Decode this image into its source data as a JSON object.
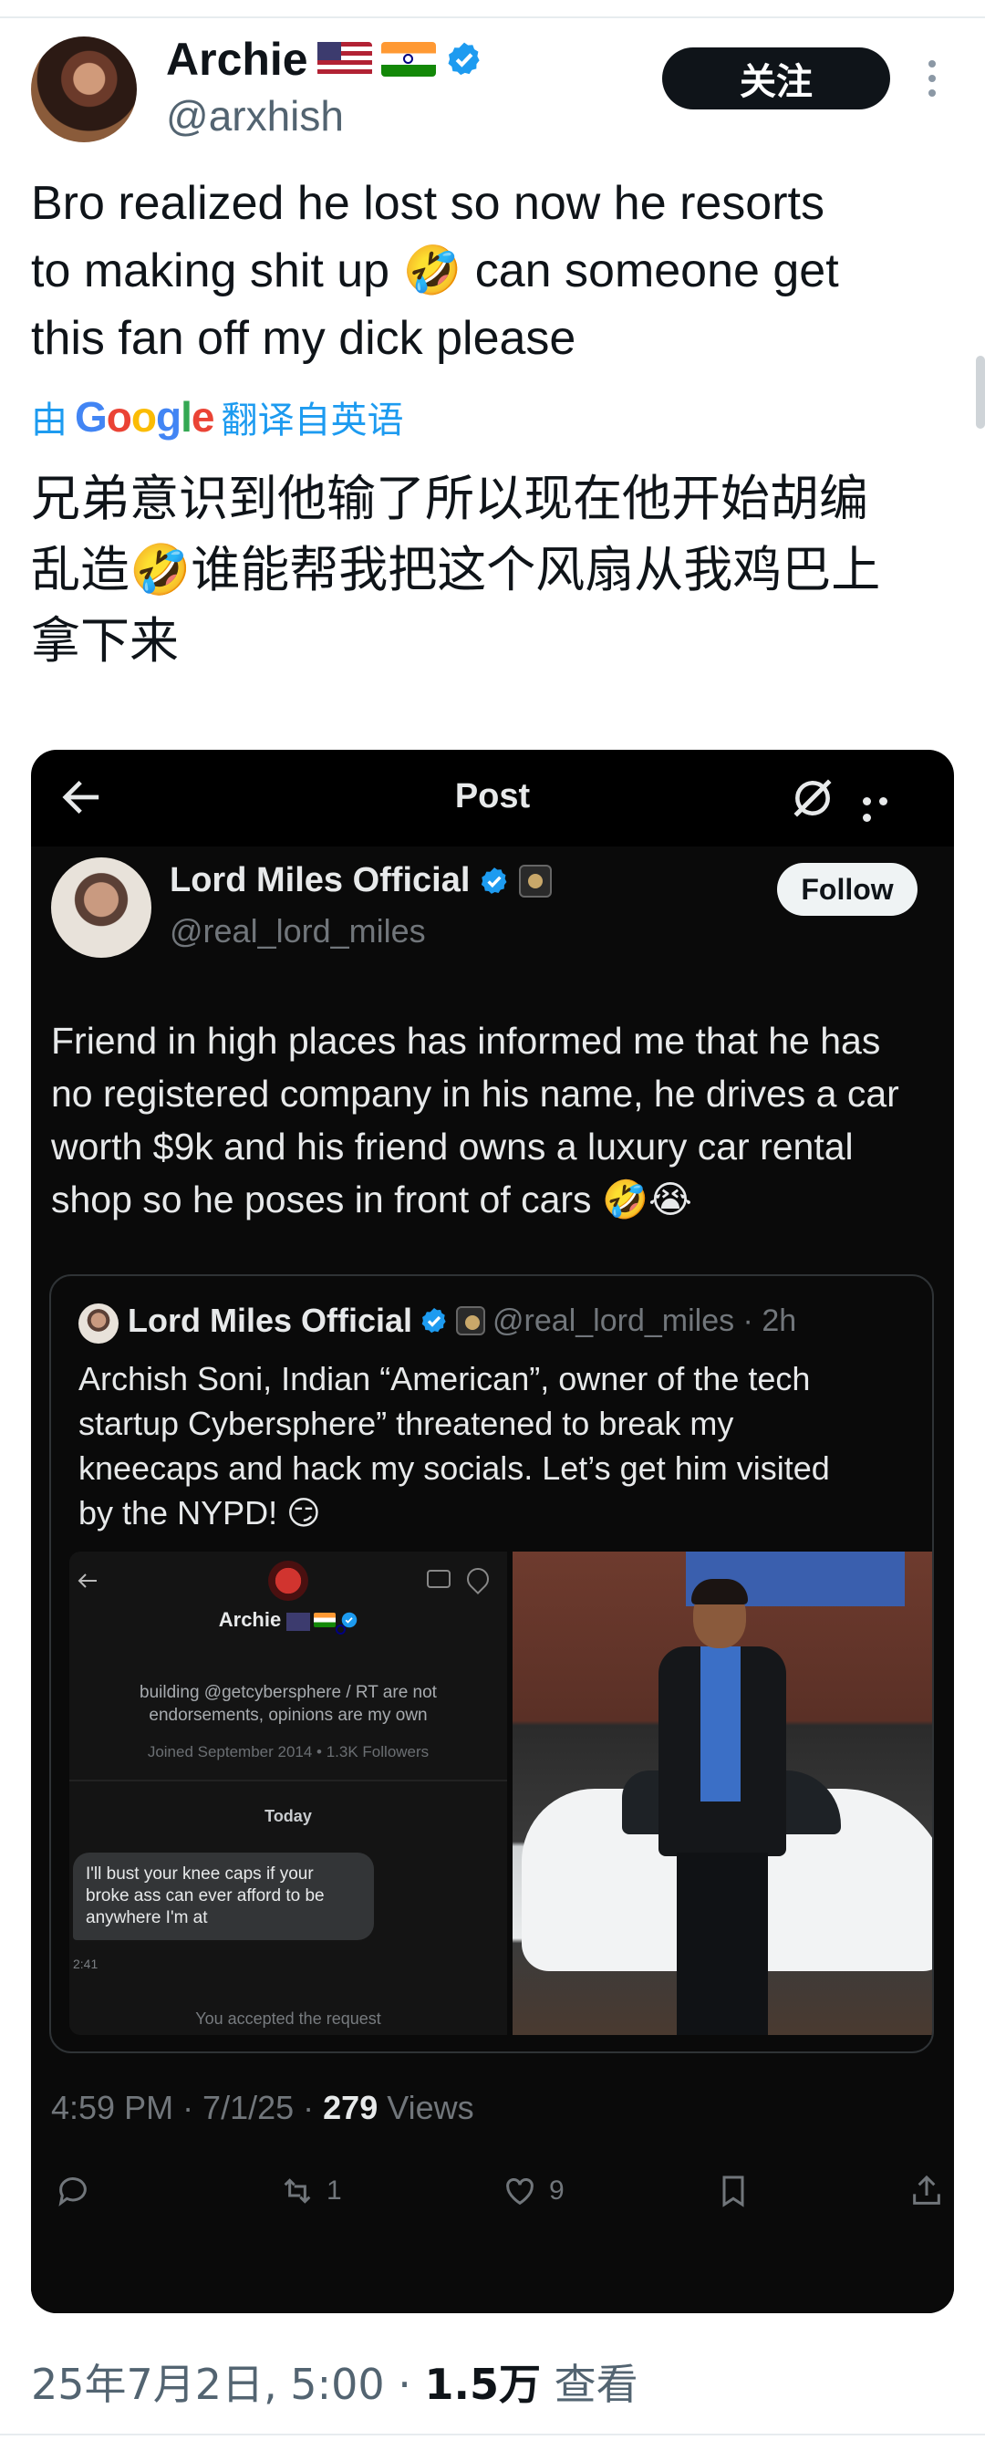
{
  "author": {
    "name": "Archie",
    "handle": "@arxhish",
    "follow_label": "关注"
  },
  "tweet": {
    "text_line1": "Bro realized he lost so now he resorts",
    "text_line2": "to making shit up 🤣 can someone get",
    "text_line3": "this fan off my dick please",
    "translate_prefix": "由",
    "translate_suffix": "翻译自英语",
    "translated_line1": "兄弟意识到他输了所以现在他开始胡编",
    "translated_line2": "乱造🤣谁能帮我把这个风扇从我鸡巴上",
    "translated_line3": "拿下来"
  },
  "embedded": {
    "title": "Post",
    "author_name": "Lord Miles Official",
    "author_handle": "@real_lord_miles",
    "follow_label": "Follow",
    "text_line1": "Friend in high places has informed me that he has",
    "text_line2": "no registered company in his name, he drives a car",
    "text_line3": "worth $9k and his friend owns a luxury car rental",
    "text_line4": "shop so he poses in front of cars 🤣😭",
    "quote": {
      "author_name": "Lord Miles Official",
      "handle_time": "@real_lord_miles · 2h",
      "text_line1": "Archish Soni, Indian “American”, owner of the tech",
      "text_line2": "startup Cybersphere” threatened to break my",
      "text_line3": "kneecaps and hack my socials. Let’s get him visited",
      "text_line4": "by the NYPD! 😏",
      "dm": {
        "name": "Archie",
        "bio": "building @getcybersphere / RT are not endorsements, opinions are my own",
        "joined": "Joined September 2014 • 1.3K Followers",
        "today": "Today",
        "message": "I'll bust your knee caps if your broke ass can ever afford to be anywhere I'm at",
        "time": "2:41",
        "accepted": "You accepted the request"
      }
    },
    "meta_time": "4:59 PM · 7/1/25 · ",
    "views_count": "279",
    "views_label": " Views",
    "retweets": "1",
    "likes": "9"
  },
  "footer": {
    "datetime": "25年7月2日, 5:00 · ",
    "views_count": "1.5万",
    "views_label": " 查看"
  },
  "colors": {
    "accent": "#1d9bf0",
    "verified": "#1d9bf0",
    "secondary_text": "#536471"
  }
}
